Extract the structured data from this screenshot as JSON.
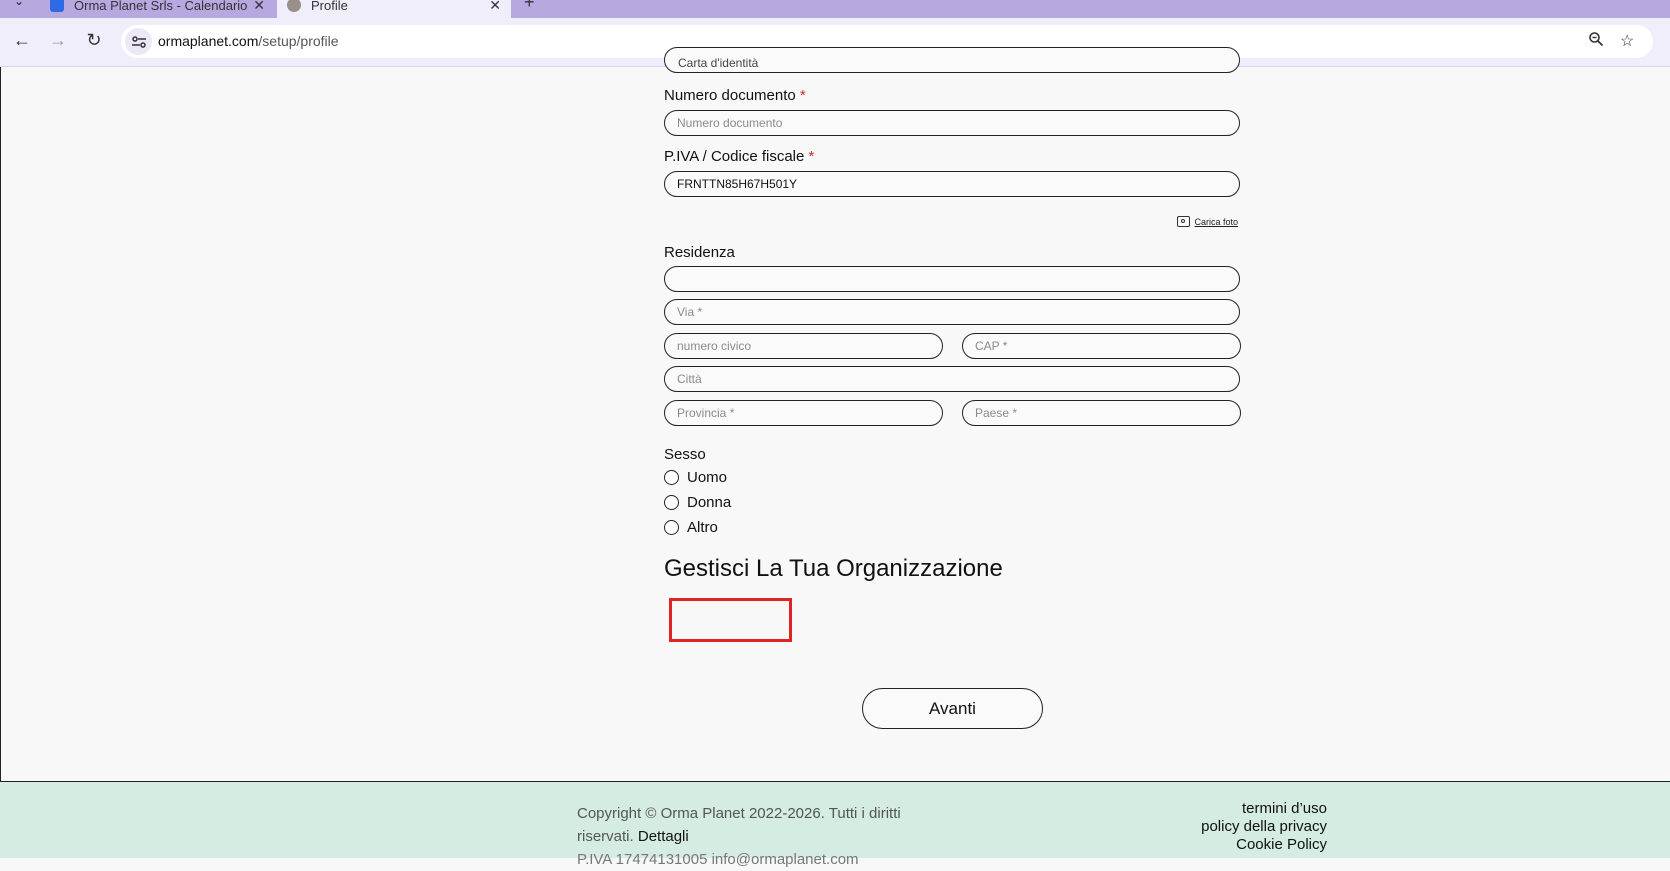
{
  "browser": {
    "tabs": [
      {
        "title": "Orma Planet Srls - Calendario -",
        "active": false
      },
      {
        "title": "Profile",
        "active": true
      }
    ],
    "url_host": "ormaplanet.com",
    "url_path": "/setup/profile"
  },
  "form": {
    "document_type_value": "Carta d'identità",
    "document_number": {
      "label": "Numero documento",
      "required_mark": "*",
      "placeholder": "Numero documento"
    },
    "tax_code": {
      "label": "P.IVA / Codice fiscale",
      "required_mark": "*",
      "value": "FRNTTN85H67H501Y"
    },
    "upload_photo_label": "Carica foto",
    "residence": {
      "label": "Residenza",
      "street_placeholder": "Via *",
      "street_number_placeholder": "numero civico",
      "postal_code_placeholder": "CAP *",
      "city_placeholder": "Città",
      "province_placeholder": "Provincia *",
      "country_placeholder": "Paese *"
    },
    "sex": {
      "label": "Sesso",
      "options": [
        "Uomo",
        "Donna",
        "Altro"
      ]
    },
    "organization_title": "Gestisci La Tua Organizzazione",
    "next_button": "Avanti"
  },
  "footer": {
    "copyright_text": "Copyright © Orma Planet 2022-2026. Tutti i diritti riservati.",
    "details_link": "Dettagli",
    "vat_text": "P.IVA 17474131005 info@ormaplanet.com",
    "links": [
      "termini d’uso",
      "policy della privacy",
      "Cookie Policy"
    ]
  },
  "colors": {
    "tabbar": "#b7a9e0",
    "toolbar": "#f1eefb",
    "page_background": "#f8f8f8",
    "footer_background": "#d4ece1",
    "required_mark": "#d12b2b",
    "highlight_box": "#e02424"
  }
}
